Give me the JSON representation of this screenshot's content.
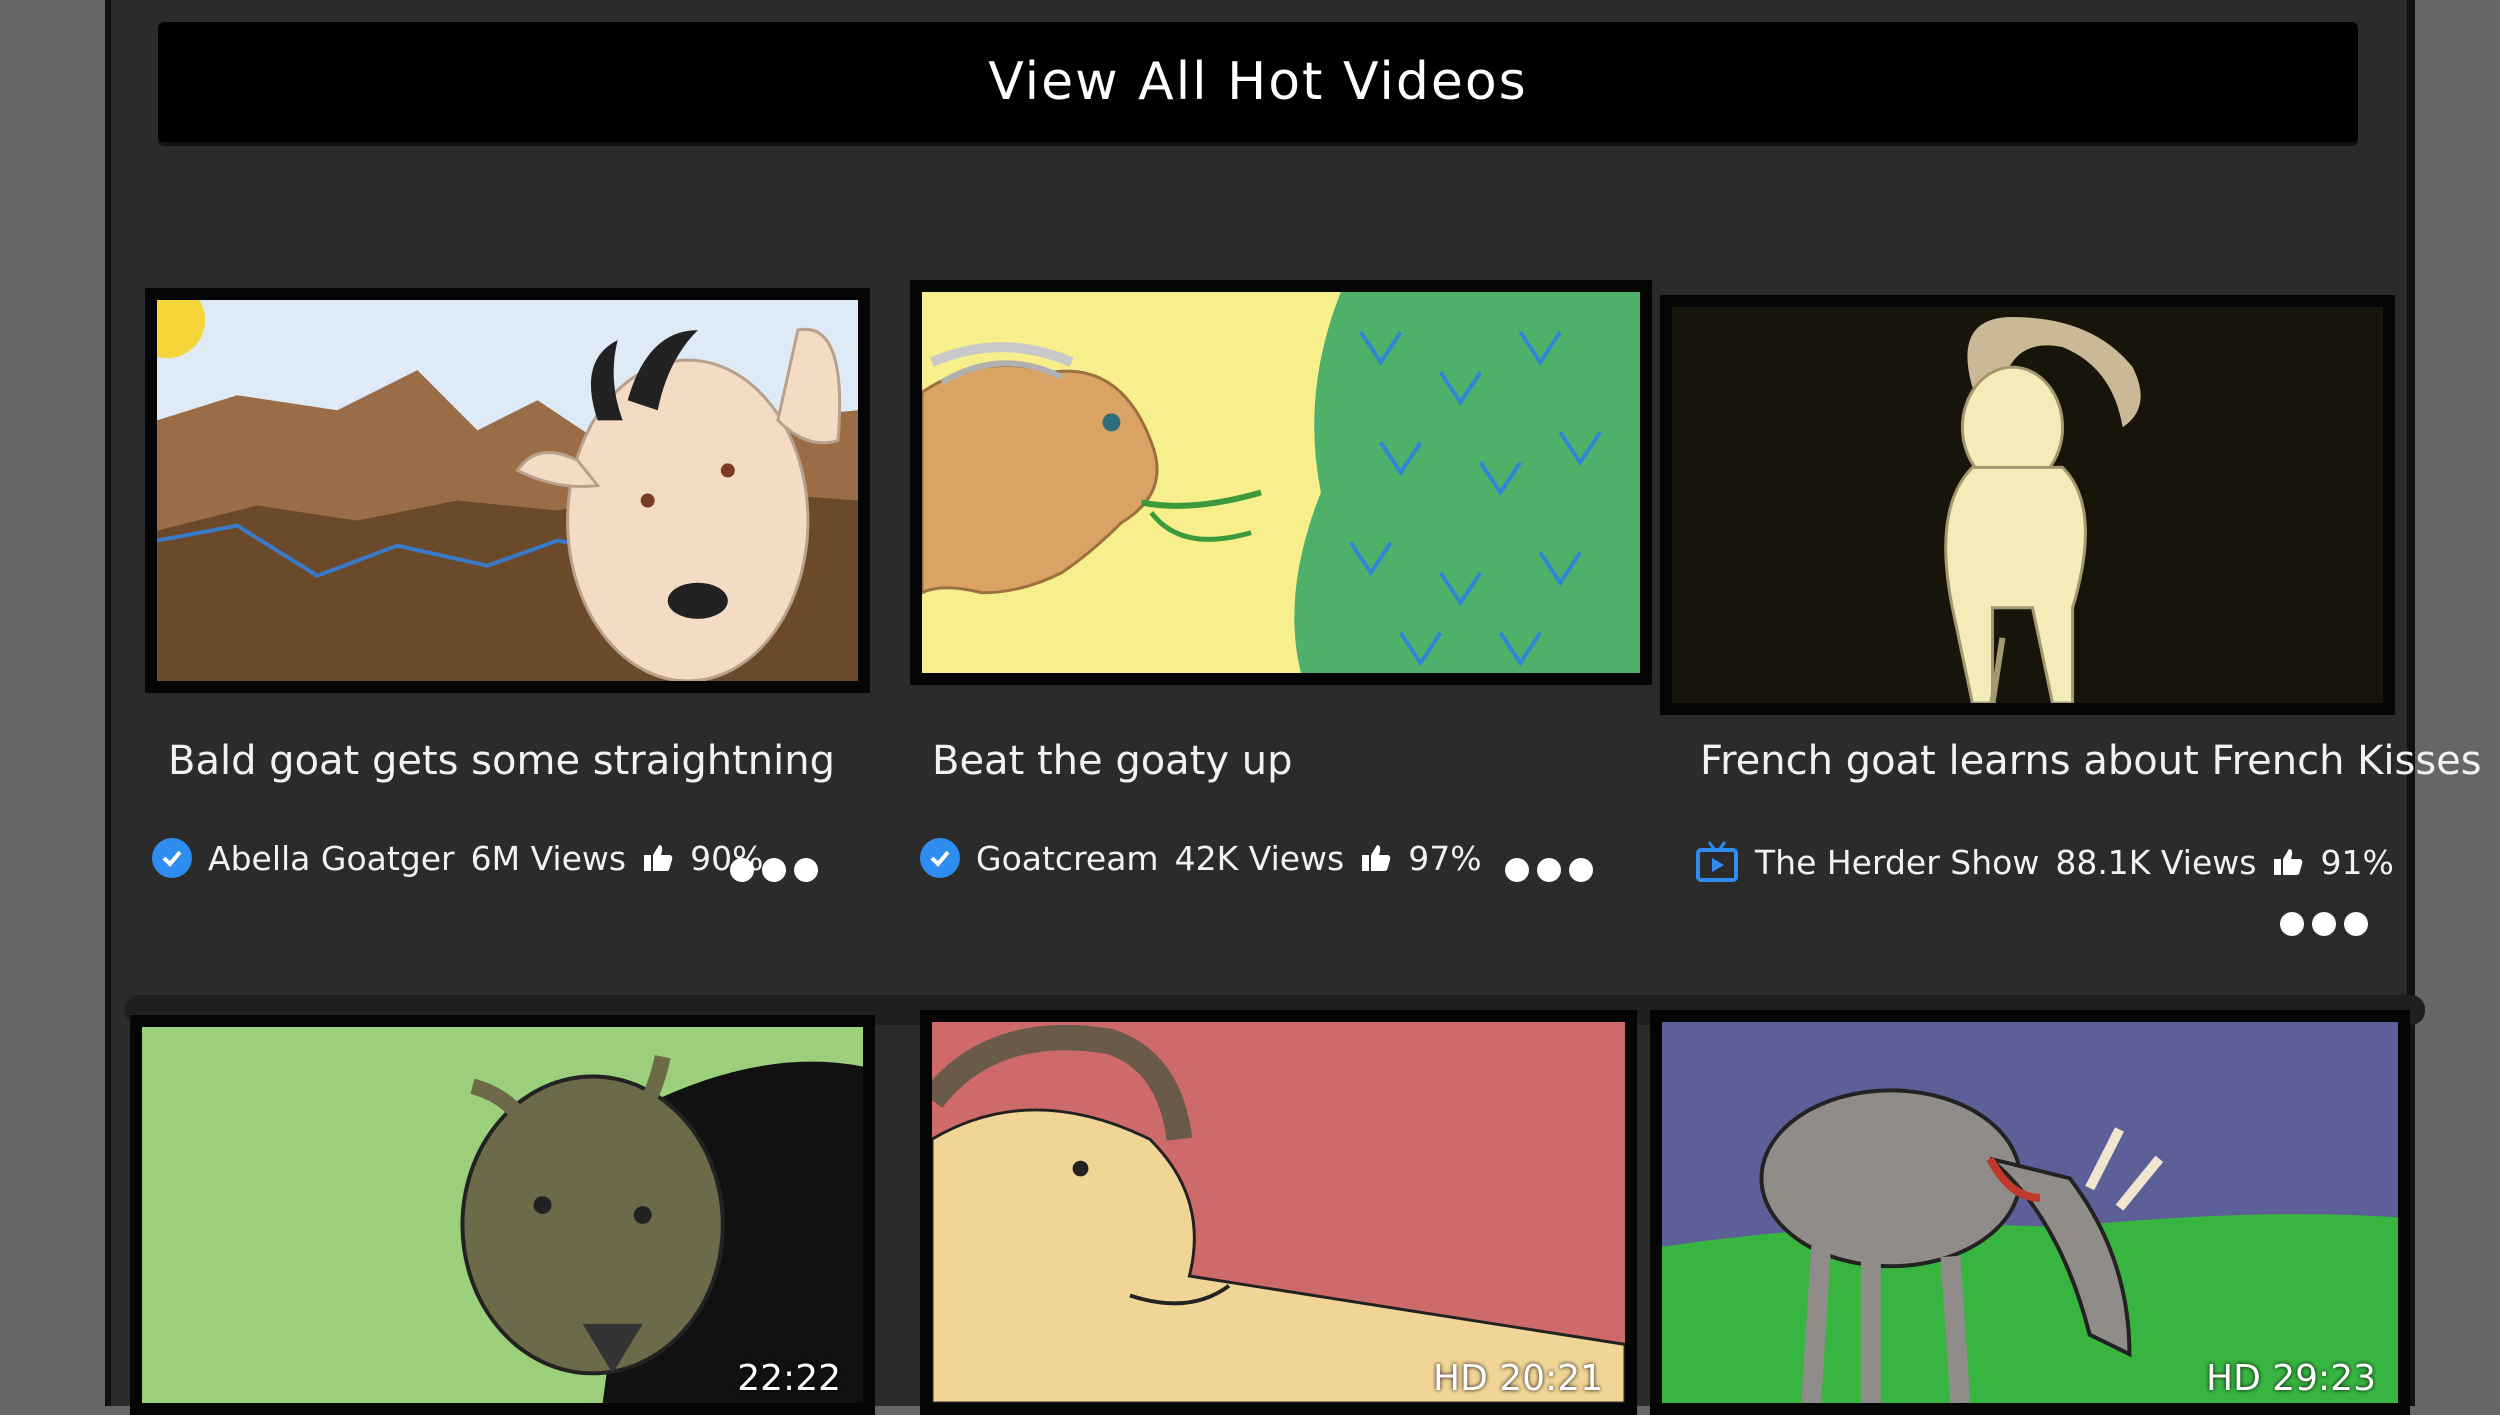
{
  "header": {
    "title": "View All Hot Videos"
  },
  "videos": [
    {
      "title": "Bald goat gets some straightning",
      "channel": "Abella Goatger",
      "channel_icon": "verified-check-icon",
      "views": "6M Views",
      "rating": "90%"
    },
    {
      "title": "Beat the goaty up",
      "channel": "Goatcream",
      "channel_icon": "verified-check-icon",
      "views": "42K Views",
      "rating": "97%"
    },
    {
      "title": "French goat learns about French Kisses",
      "channel": "The Herder Show",
      "channel_icon": "tv-icon",
      "views": "88.1K Views",
      "rating": "91%"
    },
    {
      "duration": "22:22"
    },
    {
      "duration": "HD 20:21"
    },
    {
      "duration": "HD 29:23"
    }
  ],
  "colors": {
    "panel": "#2b2b2b",
    "background": "#666666",
    "header": "#000000",
    "verified": "#2f8cf0"
  }
}
